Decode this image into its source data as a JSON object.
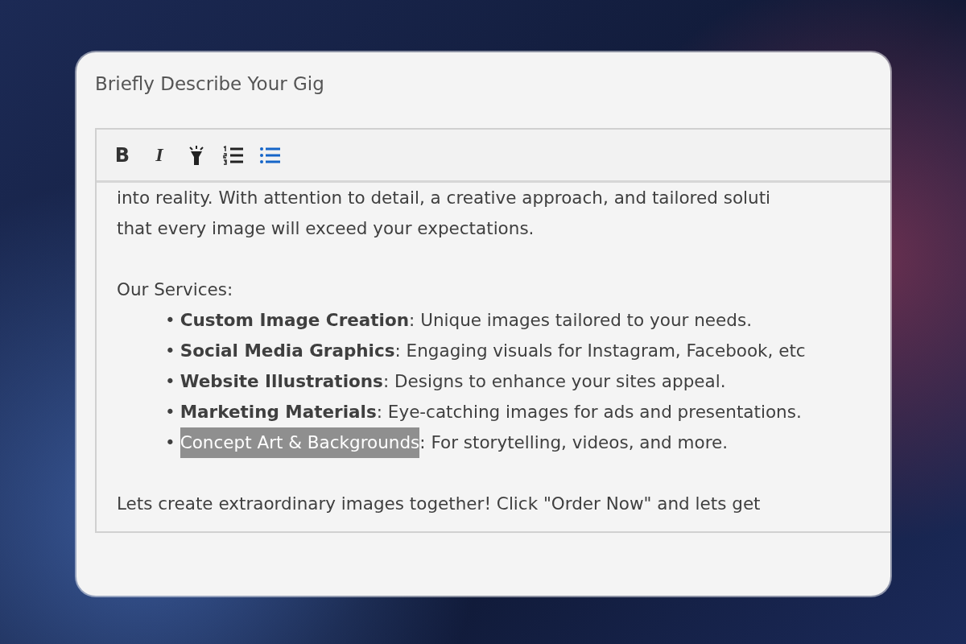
{
  "field_label": "Briefly Describe Your Gig",
  "toolbar": [
    {
      "kind": "bold",
      "label": "B",
      "active": false
    },
    {
      "kind": "italic",
      "label": "I",
      "active": false
    },
    {
      "kind": "highlight",
      "active": false
    },
    {
      "kind": "ordered_list",
      "active": false
    },
    {
      "kind": "bullet_list",
      "active": true
    }
  ],
  "intro_lines": [
    "into reality. With attention to detail, a creative approach, and tailored soluti",
    "that every image will exceed your expectations."
  ],
  "services_heading": "Our Services:",
  "services": [
    {
      "bullet": "•",
      "term": "Custom Image Creation",
      "description": ": Unique images tailored to your needs.",
      "bold": true,
      "selected": false
    },
    {
      "bullet": "•",
      "term": "Social Media Graphics",
      "description": ": Engaging visuals for Instagram, Facebook, etc",
      "bold": true,
      "selected": false
    },
    {
      "bullet": "•",
      "term": "Website Illustrations",
      "description": ": Designs to enhance your sites appeal.",
      "bold": true,
      "selected": false
    },
    {
      "bullet": "•",
      "term": "Marketing Materials",
      "description": ": Eye-catching images for ads and presentations.",
      "bold": true,
      "selected": false
    },
    {
      "bullet": "•",
      "term": "Concept Art & Backgrounds",
      "description": ": For storytelling, videos, and more.",
      "bold": false,
      "selected": true
    }
  ],
  "closing": "Lets create extraordinary images together! Click \"Order Now\" and lets get"
}
